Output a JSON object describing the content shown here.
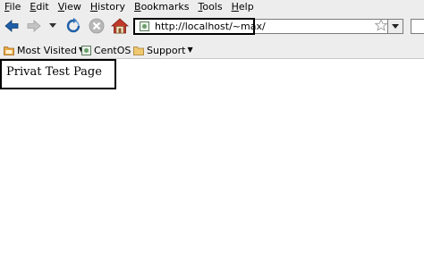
{
  "menu": {
    "file": {
      "accel": "F",
      "rest": "ile"
    },
    "edit": {
      "accel": "E",
      "rest": "dit"
    },
    "view": {
      "accel": "V",
      "rest": "iew"
    },
    "history": {
      "accel": "H",
      "rest": "istory"
    },
    "bookmarks": {
      "accel": "B",
      "rest": "ookmarks"
    },
    "tools": {
      "accel": "T",
      "rest": "ools"
    },
    "help": {
      "accel": "H",
      "rest": "elp"
    }
  },
  "nav": {
    "back_icon": "arrow-left-icon",
    "forward_icon": "arrow-right-icon",
    "history_dropdown_icon": "chevron-down-icon",
    "reload_icon": "reload-icon",
    "stop_icon": "stop-icon",
    "home_icon": "home-icon"
  },
  "address": {
    "url": "http://localhost/~max/"
  },
  "bookmarks": {
    "most_visited": "Most Visited",
    "centos": "CentOS",
    "support": "Support"
  },
  "page": {
    "heading": "Privat Test Page"
  },
  "colors": {
    "chrome": "#ededed",
    "highlight_box": "#000000",
    "back_arrow": "#1f5fa8",
    "stop_inactive": "#b8b8b8",
    "home_roof": "#c0392b"
  }
}
